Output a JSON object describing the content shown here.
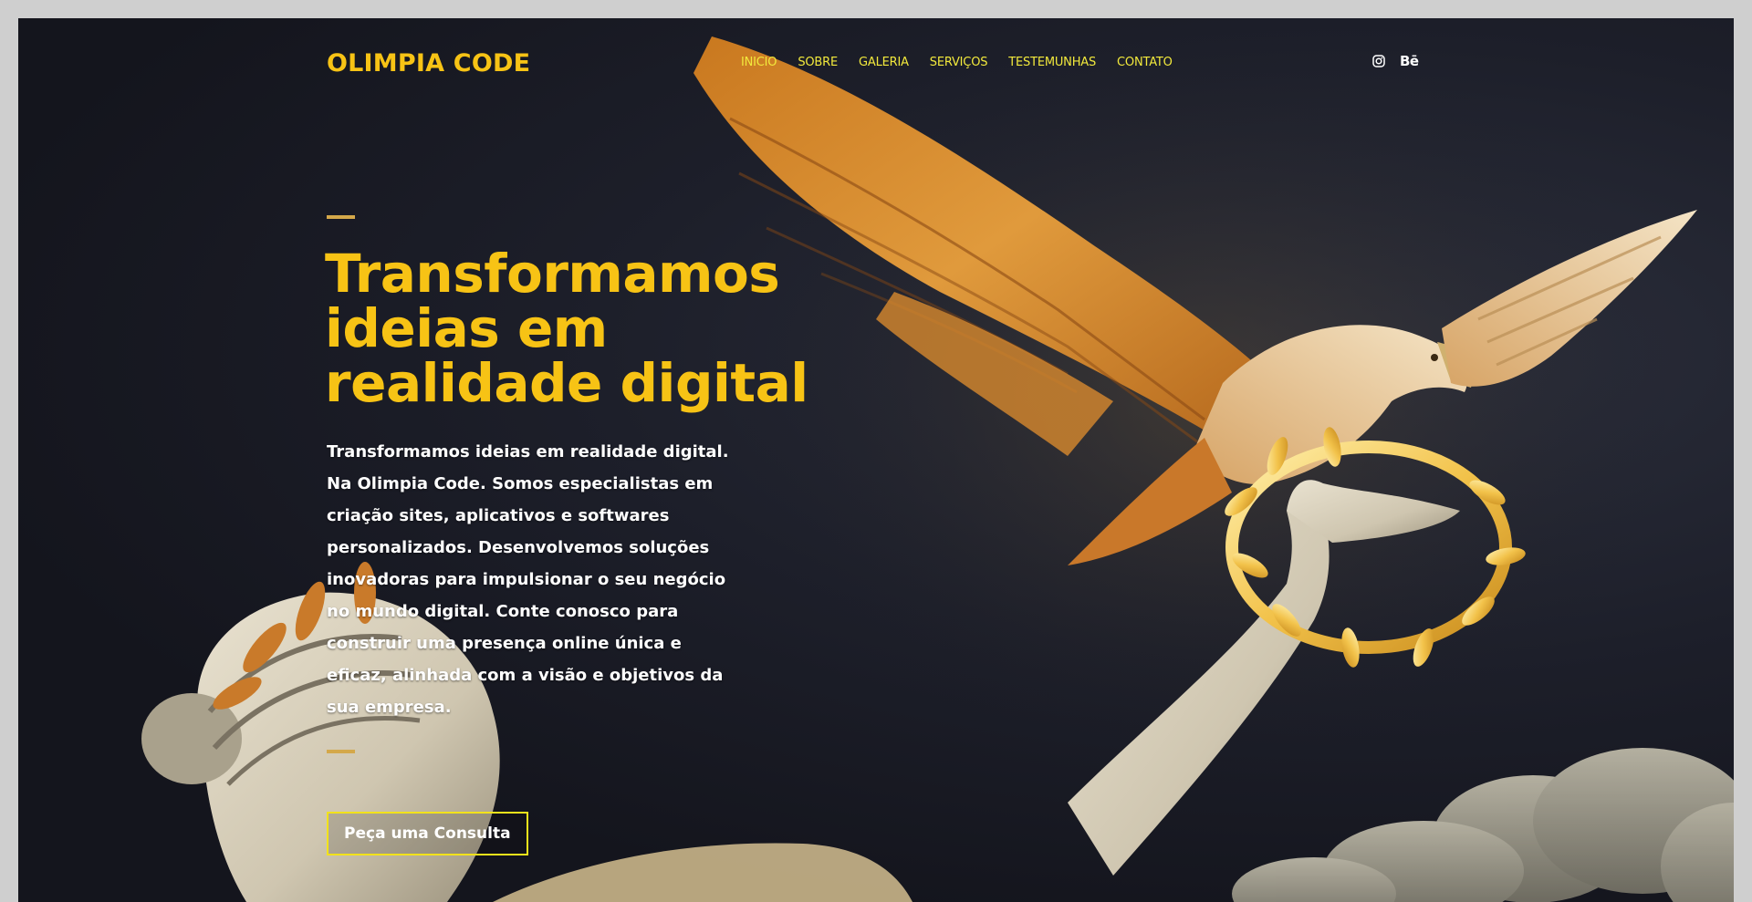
{
  "brand": {
    "name": "OLIMPIA CODE",
    "accent_color": "#f7c315",
    "nav_color": "#f2e93c",
    "background_color": "#15161e"
  },
  "nav": {
    "items": [
      {
        "label": "INICIO"
      },
      {
        "label": "SOBRE"
      },
      {
        "label": "GALERIA"
      },
      {
        "label": "SERVIÇOS"
      },
      {
        "label": "TESTEMUNHAS"
      },
      {
        "label": "CONTATO"
      }
    ]
  },
  "social": {
    "instagram_icon": "instagram-icon",
    "behance_label": "Bē"
  },
  "hero": {
    "title_line1": "Transformamos",
    "title_line2": "ideias em",
    "title_line3": "realidade digital",
    "paragraph": "Transformamos ideias em realidade digital. Na Olimpia Code. Somos especialistas em criação sites, aplicativos e softwares personalizados. Desenvolvemos soluções inovadoras para impulsionar o seu negócio no mundo digital. Conte conosco para construir uma presença online única e eficaz, alinhada com a visão e objetivos da sua empresa.",
    "cta_label": "Peça uma Consulta"
  }
}
